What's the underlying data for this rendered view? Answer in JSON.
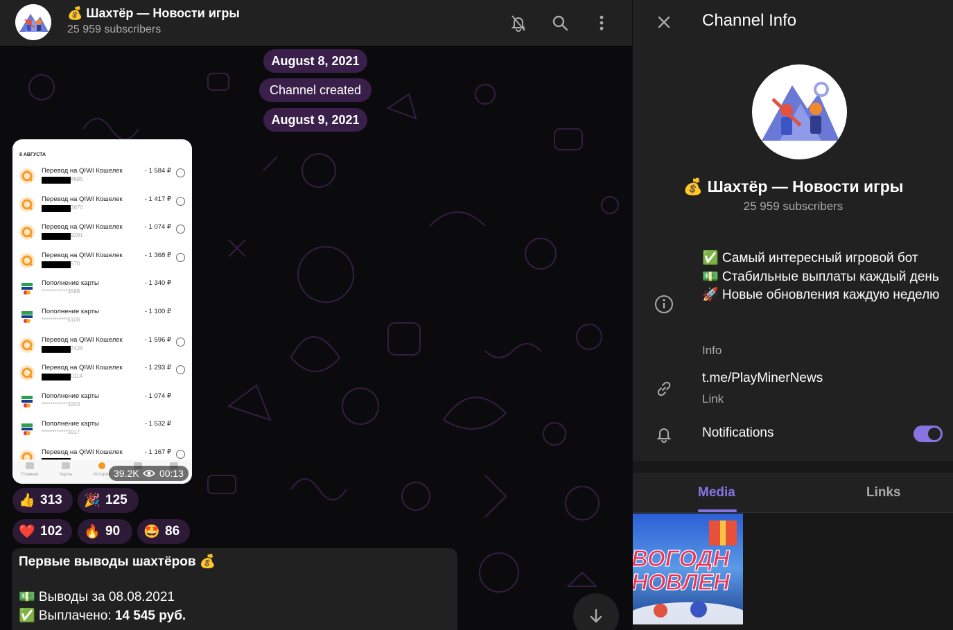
{
  "header": {
    "title": "💰 Шахтёр — Новости игры",
    "subscribers": "25 959 subscribers"
  },
  "service_messages": [
    "August 8, 2021",
    "Channel created",
    "August 9, 2021"
  ],
  "screenshot": {
    "date_header": "8 АВГУСТА",
    "transactions": [
      {
        "name": "Перевод на QIWI Кошелек",
        "sub": "4685",
        "amount": "- 1 584 ₽",
        "icon": "qiwi"
      },
      {
        "name": "Перевод на QIWI Кошелек",
        "sub": "3870",
        "amount": "- 1 417 ₽",
        "icon": "qiwi"
      },
      {
        "name": "Перевод на QIWI Кошелек",
        "sub": "9281",
        "amount": "- 1 074 ₽",
        "icon": "qiwi"
      },
      {
        "name": "Перевод на QIWI Кошелек",
        "sub": "570",
        "amount": "- 1 368 ₽",
        "icon": "qiwi"
      },
      {
        "name": "Пополнение карты",
        "sub": "************3588",
        "amount": "- 1 340 ₽",
        "icon": "mir"
      },
      {
        "name": "Пополнение карты",
        "sub": "************6108",
        "amount": "- 1 100 ₽",
        "icon": "mir"
      },
      {
        "name": "Перевод на QIWI Кошелек",
        "sub": "7426",
        "amount": "- 1 596 ₽",
        "icon": "qiwi"
      },
      {
        "name": "Перевод на QIWI Кошелек",
        "sub": "0114",
        "amount": "- 1 293 ₽",
        "icon": "qiwi"
      },
      {
        "name": "Пополнение карты",
        "sub": "************3203",
        "amount": "- 1 074 ₽",
        "icon": "mir"
      },
      {
        "name": "Пополнение карты",
        "sub": "************3917",
        "amount": "- 1 532 ₽",
        "icon": "mir"
      },
      {
        "name": "Перевод на QIWI Кошелек",
        "sub": "",
        "amount": "- 1 167 ₽",
        "icon": "qiwi"
      }
    ],
    "tabbar": [
      "Главная",
      "Карты",
      "История",
      "",
      ""
    ],
    "views": "39.2K",
    "time": "00:13"
  },
  "reactions": [
    {
      "emoji": "👍",
      "count": "313"
    },
    {
      "emoji": "🎉",
      "count": "125"
    },
    {
      "emoji": "❤️",
      "count": "102"
    },
    {
      "emoji": "🔥",
      "count": "90"
    },
    {
      "emoji": "🤩",
      "count": "86"
    }
  ],
  "message": {
    "title": "Первые выводы шахтёров 💰",
    "line1": "💵 Выводы за 08.08.2021",
    "line2_prefix": "✅ Выплачено: ",
    "line2_bold": "14 545 руб."
  },
  "panel": {
    "title": "Channel Info",
    "name": "💰 Шахтёр — Новости игры",
    "subscribers": "25 959 subscribers",
    "description": [
      "✅ Самый интересный игровой бот",
      "💵 Стабильные выплаты каждый день",
      "🚀 Новые обновления каждую неделю"
    ],
    "description_label": "Info",
    "link": "t.me/PlayMinerNews",
    "link_label": "Link",
    "notifications_label": "Notifications",
    "notifications_on": true,
    "tabs": [
      "Media",
      "Links"
    ],
    "media_thumb_text": [
      "ВОГОДН",
      "НОВЛЕН"
    ]
  },
  "colors": {
    "accent": "#8774e1",
    "pill_bg": "#3b1f4b",
    "reaction_bg": "#2c1a37",
    "qiwi": "#f59a21"
  }
}
